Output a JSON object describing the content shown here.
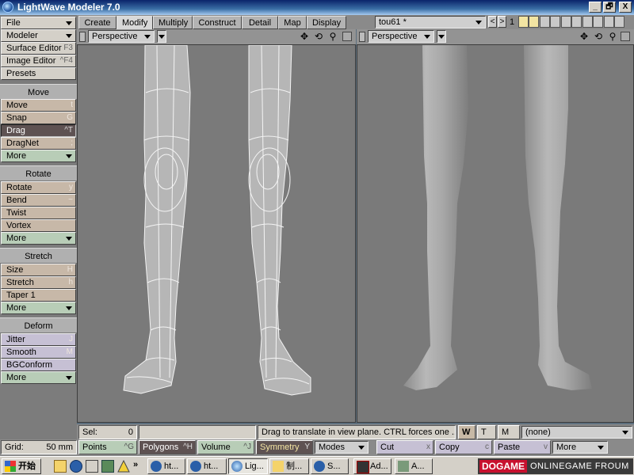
{
  "window": {
    "title": "LightWave Modeler 7.0",
    "controls": [
      "_",
      "🗗",
      "X"
    ]
  },
  "left_panel": {
    "file": "File",
    "modeler": "Modeler",
    "surface_editor": {
      "label": "Surface Editor",
      "shortcut": "F3"
    },
    "image_editor": {
      "label": "Image Editor",
      "shortcut": "^F4"
    },
    "presets": "Presets",
    "move_header": "Move",
    "move_items": [
      {
        "label": "Move",
        "shortcut": "t"
      },
      {
        "label": "Snap",
        "shortcut": "G"
      },
      {
        "label": "Drag",
        "shortcut": "^T"
      },
      {
        "label": "DragNet",
        "shortcut": ";"
      }
    ],
    "more": "More",
    "rotate_header": "Rotate",
    "rotate_items": [
      {
        "label": "Rotate",
        "shortcut": "y"
      },
      {
        "label": "Bend",
        "shortcut": "~"
      },
      {
        "label": "Twist",
        "shortcut": ""
      },
      {
        "label": "Vortex",
        "shortcut": ""
      }
    ],
    "stretch_header": "Stretch",
    "stretch_items": [
      {
        "label": "Size",
        "shortcut": "H"
      },
      {
        "label": "Stretch",
        "shortcut": "h"
      },
      {
        "label": "Taper 1",
        "shortcut": ""
      }
    ],
    "deform_header": "Deform",
    "deform_items": [
      {
        "label": "Jitter",
        "shortcut": "J"
      },
      {
        "label": "Smooth",
        "shortcut": "M"
      },
      {
        "label": "BGConform",
        "shortcut": ""
      }
    ],
    "grid_label": "Grid:",
    "grid_value": "50 mm"
  },
  "tabs": [
    "Create",
    "Modify",
    "Multiply",
    "Construct",
    "Detail",
    "Map",
    "Display"
  ],
  "active_tab": "Modify",
  "object": {
    "name": "tou61 *",
    "nav_prev": "<",
    "nav_next": ">",
    "layer_number": "1"
  },
  "viewports": [
    {
      "view": "Perspective"
    },
    {
      "view": "Perspective"
    }
  ],
  "status": {
    "sel_label": "Sel:",
    "sel_value": "0",
    "hint": "Drag to translate in view plane. CTRL forces one ...",
    "wtm": [
      "W",
      "T",
      "M"
    ],
    "surface": "(none)"
  },
  "bottom": {
    "points": {
      "label": "Points",
      "shortcut": "^G"
    },
    "polygons": {
      "label": "Polygons",
      "shortcut": "^H"
    },
    "volume": {
      "label": "Volume",
      "shortcut": "^J"
    },
    "symmetry": {
      "label": "Symmetry",
      "shortcut": "Y"
    },
    "modes": "Modes",
    "cut": {
      "label": "Cut",
      "shortcut": "x"
    },
    "copy": {
      "label": "Copy",
      "shortcut": "c"
    },
    "paste": {
      "label": "Paste",
      "shortcut": "v"
    },
    "more": "More"
  },
  "taskbar": {
    "start": "开始",
    "chevron": "»",
    "items": [
      "ht...",
      "ht...",
      "Lig...",
      "制...",
      "S...",
      "Ad...",
      "A..."
    ],
    "watermark_logo": "DOGAME",
    "watermark_text": "ONLINEGAME FROUM"
  },
  "colors": {
    "move_group": "#c7b8a8",
    "rotate_group": "#c7b8a8",
    "deform_group": "#c6c0d4",
    "active_tool": "#5e5252",
    "symmetry_active": "#f2e4a2"
  }
}
